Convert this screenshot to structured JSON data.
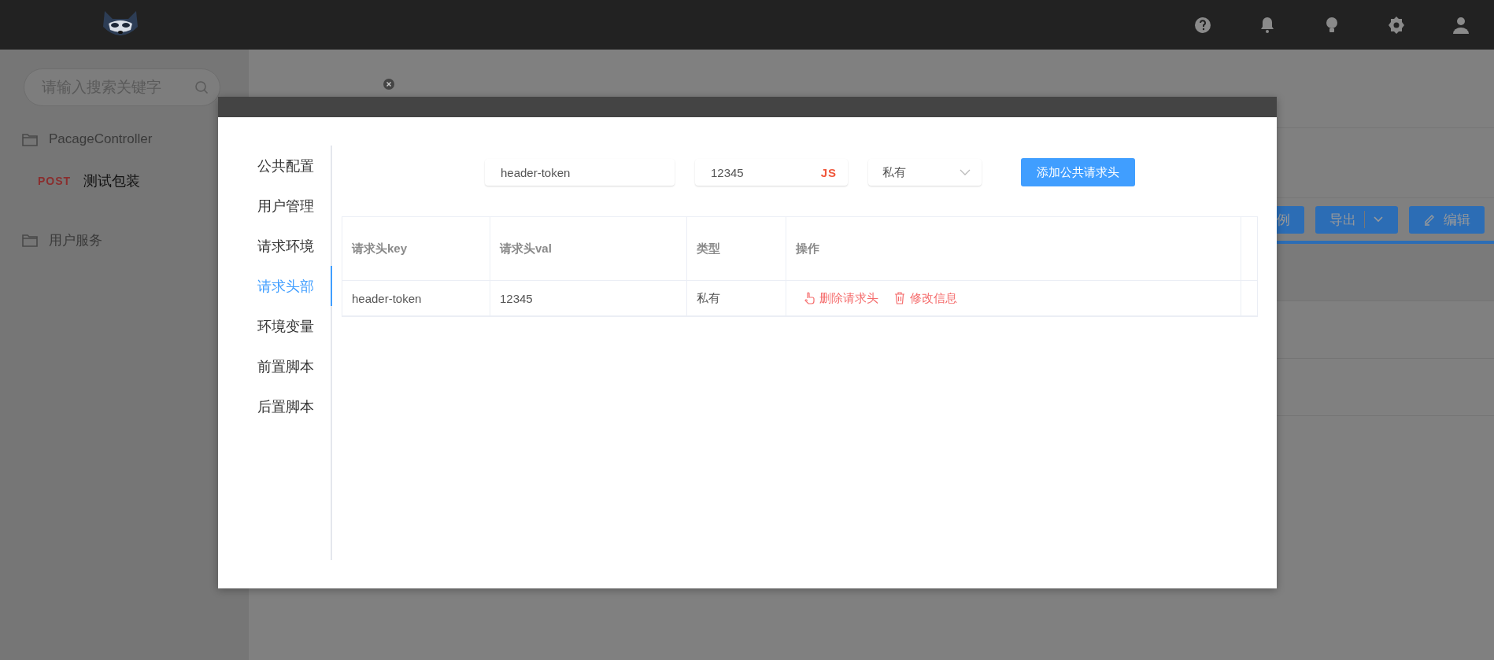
{
  "sidebar": {
    "search": {
      "placeholder": "请输入搜索关键字"
    },
    "tree": [
      {
        "kind": "folder",
        "label": "PacageController",
        "children": [
          {
            "kind": "request",
            "method": "POST",
            "label": "测试包装"
          }
        ]
      },
      {
        "kind": "folder",
        "label": "用户服务"
      }
    ]
  },
  "toolbar": {
    "buttons": [
      {
        "kind": "plain",
        "label": "例"
      },
      {
        "kind": "dropdown",
        "label": "导出"
      },
      {
        "kind": "edit",
        "label": "编辑"
      }
    ]
  },
  "dialog": {
    "menu": [
      {
        "label": "公共配置",
        "selected": false
      },
      {
        "label": "用户管理",
        "selected": false
      },
      {
        "label": "请求环境",
        "selected": false
      },
      {
        "label": "请求头部",
        "selected": true
      },
      {
        "label": "环境变量",
        "selected": false
      },
      {
        "label": "前置脚本",
        "selected": false
      },
      {
        "label": "后置脚本",
        "selected": false
      }
    ],
    "form": {
      "key_input": {
        "value": "header-token"
      },
      "val_input": {
        "value": "12345",
        "badge": "JS"
      },
      "type_select": {
        "value": "私有"
      },
      "add_button": "添加公共请求头"
    },
    "table": {
      "columns": [
        "请求头key",
        "请求头val",
        "类型",
        "操作"
      ],
      "rows": [
        {
          "key": "header-token",
          "val": "12345",
          "type": "私有",
          "actions": [
            {
              "kind": "delete",
              "label": "删除请求头"
            },
            {
              "kind": "edit",
              "label": "修改信息"
            }
          ]
        }
      ]
    }
  }
}
